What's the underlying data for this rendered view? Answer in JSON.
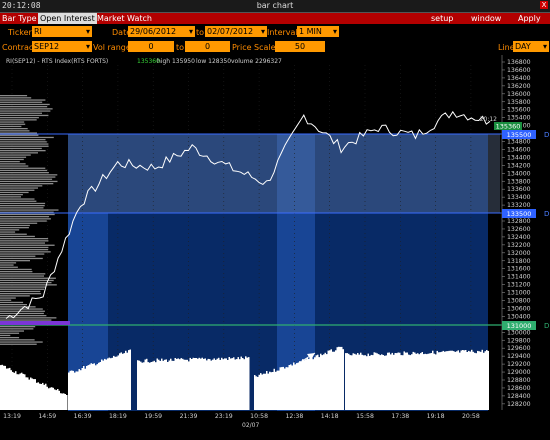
{
  "window": {
    "time": "20:12:08",
    "title": "bar chart",
    "close_label": "X"
  },
  "menu": {
    "bar_type": "Bar Type",
    "open_interest": "Open Interest",
    "market_watch": "Market Watch",
    "setup": "setup",
    "window": "window",
    "apply": "Apply"
  },
  "controls": {
    "ticker_label": "Ticker",
    "ticker_value": "RI",
    "date_label": "Date",
    "date_from": "29/06/2012",
    "to_label": "to",
    "date_to": "02/07/2012",
    "interval_label": "Interval",
    "interval_value": "1 MIN",
    "contract_label": "Contract",
    "contract_value": "SEP12",
    "vol_range_label": "Vol range",
    "vol_from": "0",
    "vol_to_label": "to",
    "vol_to": "0",
    "price_scale_label": "Price Scale",
    "price_scale_value": "50",
    "line_label": "Line",
    "line_value": "DAY"
  },
  "chart_info": {
    "symbol": "RI(SEP12) - RTS Index(RTS FORTS)",
    "last": "135360",
    "high": "high 135950",
    "low": "low 128350",
    "volume": "volume 2296327"
  },
  "price_axis": [
    "136800",
    "136600",
    "136400",
    "136200",
    "136000",
    "135800",
    "135600",
    "135400",
    "135200",
    "135000",
    "134800",
    "134600",
    "134400",
    "134200",
    "134000",
    "133800",
    "133600",
    "133400",
    "133200",
    "133000",
    "132800",
    "132600",
    "132400",
    "132200",
    "132000",
    "131800",
    "131600",
    "131400",
    "131200",
    "131000",
    "130800",
    "130600",
    "130400",
    "130200",
    "130000",
    "129800",
    "129600",
    "129400",
    "129200",
    "129000",
    "128800",
    "128600",
    "128400",
    "128200"
  ],
  "time_axis": [
    "13:19",
    "14:59",
    "16:39",
    "18:19",
    "19:59",
    "21:39",
    "23:19",
    "10:58",
    "12:38",
    "14:18",
    "15:58",
    "17:38",
    "19:18",
    "20:58"
  ],
  "date_label": "02/07",
  "price_tags": {
    "last": "135360",
    "last_time": "20:12",
    "level_high": "135500",
    "level_mid": "133500",
    "level_low": "131000",
    "tag_d": "D"
  },
  "colors": {
    "menu_red": "#b30000",
    "field_orange": "#ff9900",
    "label_orange": "#ff8c00",
    "chart_navy": "#082a66",
    "level_blue": "#3a6cff",
    "level_green": "#2fae6f"
  },
  "chart_data": {
    "type": "line",
    "x": [
      "13:19",
      "14:59",
      "16:39",
      "18:19",
      "19:59",
      "21:39",
      "23:19",
      "10:58",
      "12:38",
      "14:18",
      "15:58",
      "17:38",
      "19:18",
      "20:12"
    ],
    "series": [
      {
        "values": [
          130400,
          131000,
          133300,
          134300,
          134200,
          134700,
          134200,
          133800,
          135500,
          134700,
          135200,
          135000,
          135600,
          135360
        ]
      }
    ],
    "ylim": [
      128200,
      136800
    ],
    "levels": [
      135500,
      133500,
      131000
    ]
  }
}
